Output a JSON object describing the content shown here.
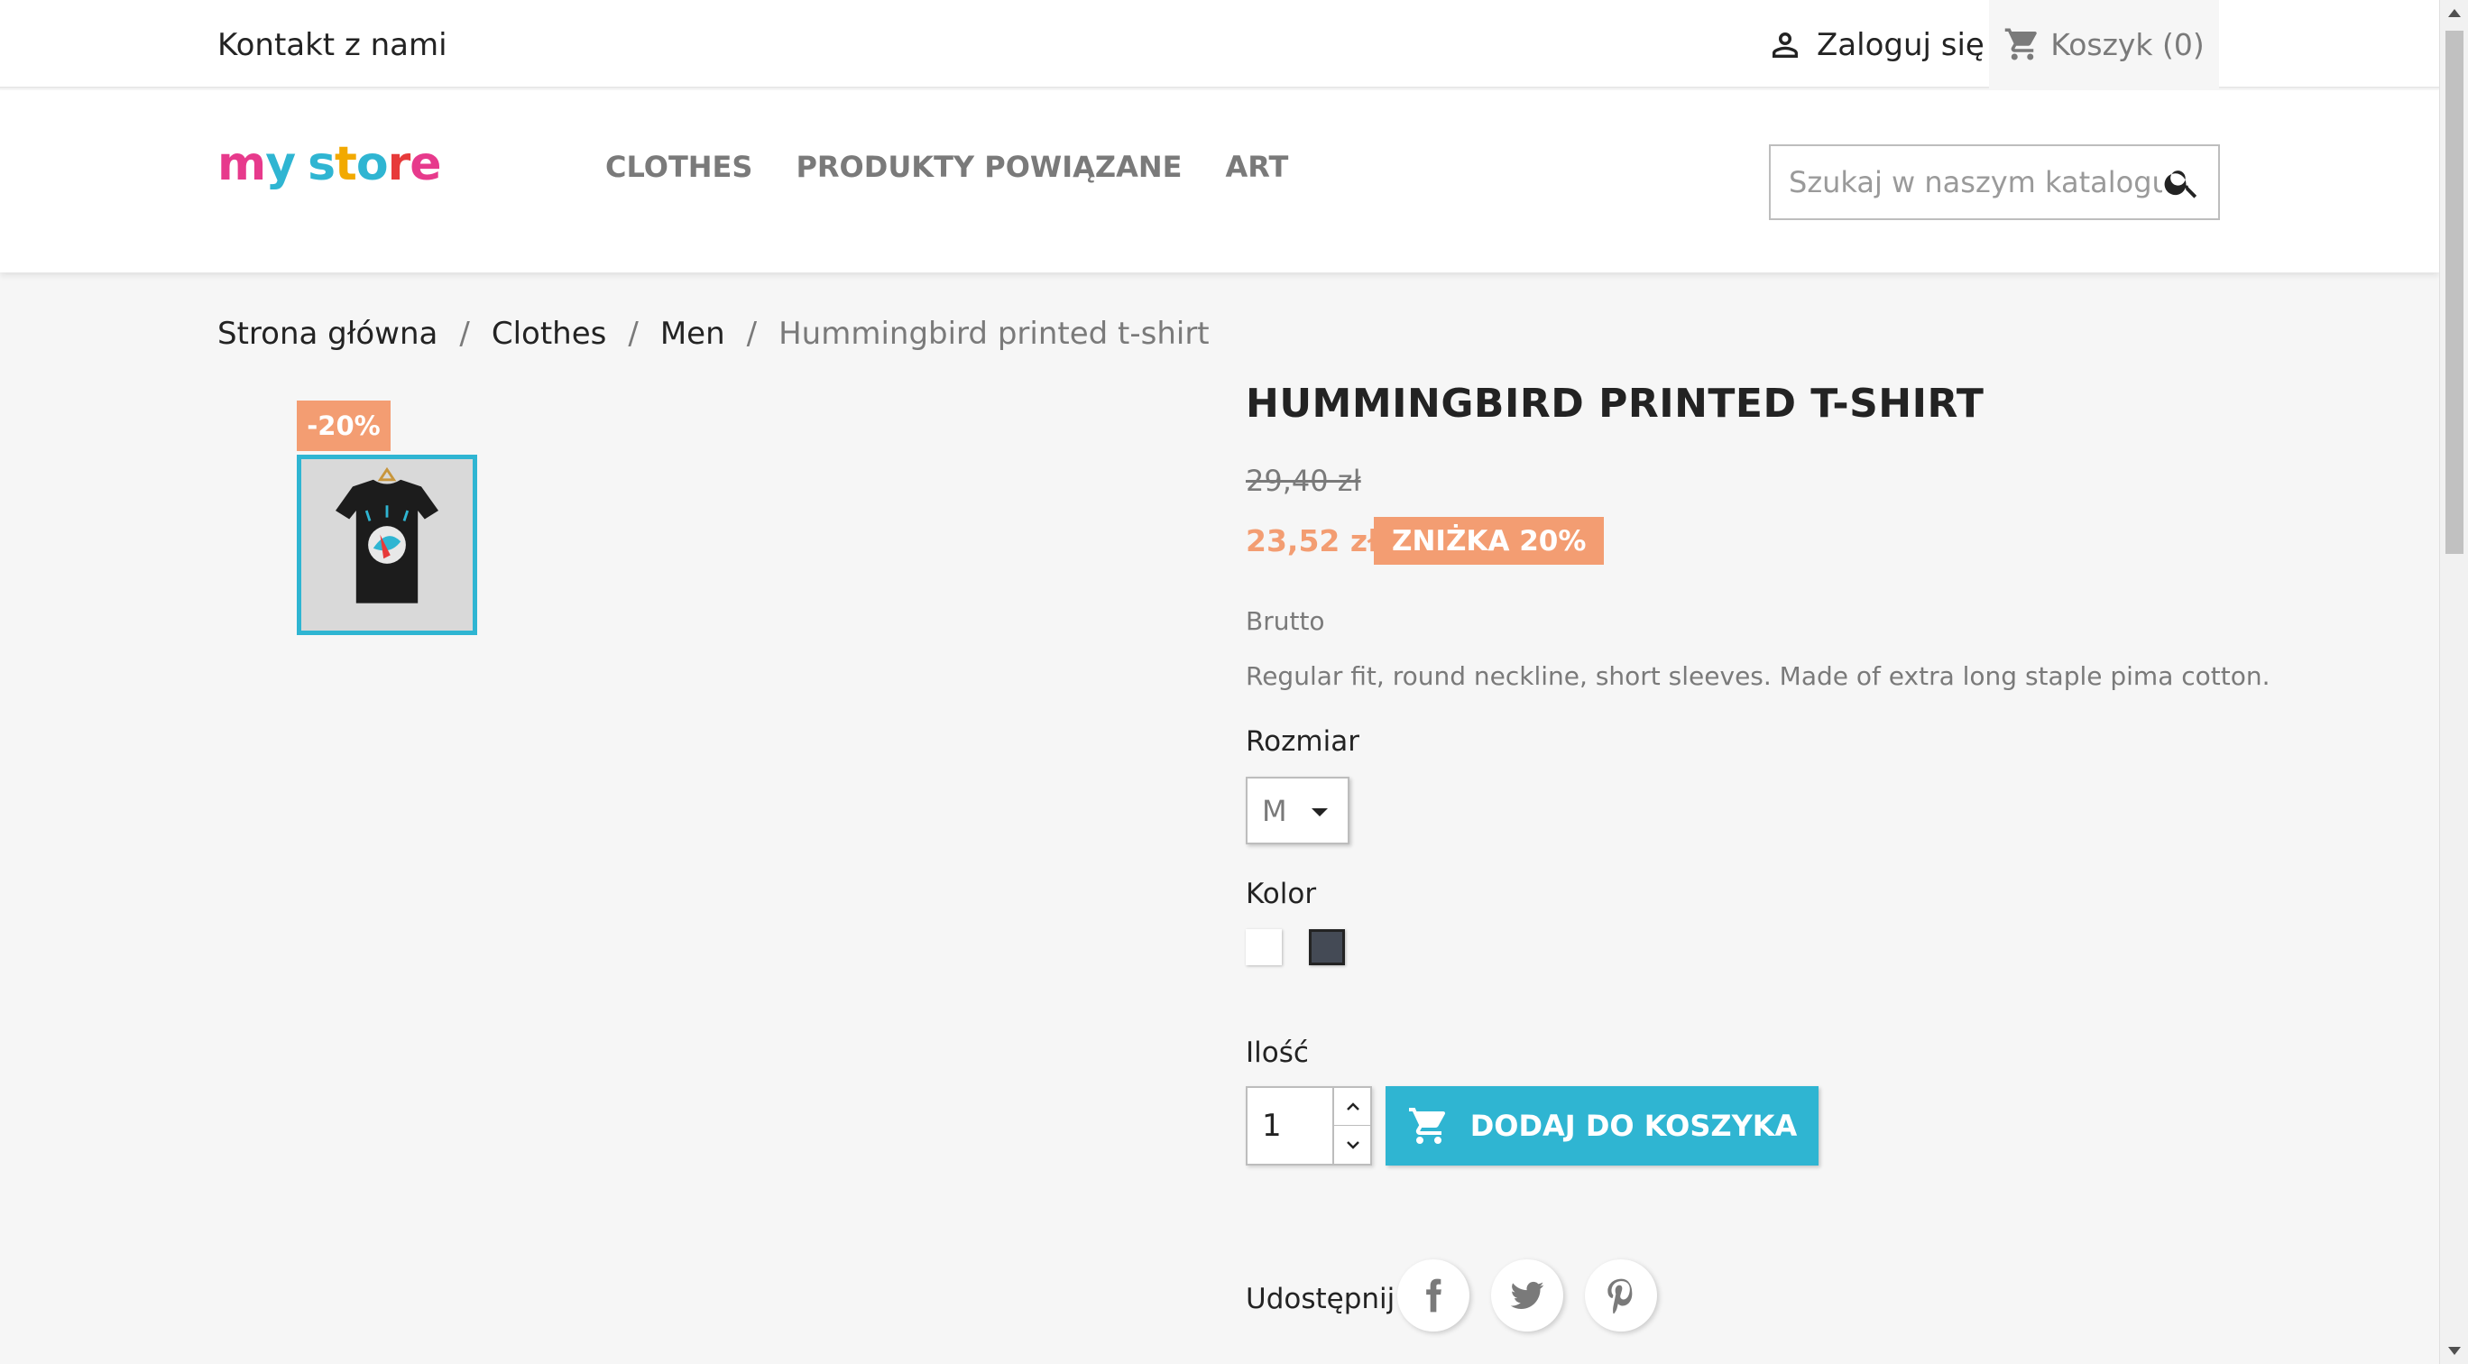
{
  "topbar": {
    "contact": "Kontakt z nami",
    "login": "Zaloguj się",
    "cart": "Koszyk (0)"
  },
  "header": {
    "logo": [
      "m",
      "y",
      " ",
      "s",
      "t",
      "o",
      "r",
      "e"
    ],
    "logo_colors": [
      "#e73a8c",
      "#2fb5d2",
      "#ffffff",
      "#2fb5d2",
      "#f2a900",
      "#2fb5d2",
      "#e73a3a",
      "#e73a8c"
    ],
    "nav": [
      "CLOTHES",
      "PRODUKTY POWIĄZANE",
      "ART"
    ],
    "search_placeholder": "Szukaj w naszym katalogu"
  },
  "breadcrumb": [
    "Strona główna",
    "Clothes",
    "Men",
    "Hummingbird printed t-shirt"
  ],
  "product": {
    "discount_flag": "-20%",
    "title": "HUMMINGBIRD PRINTED T-SHIRT",
    "old_price": "29,40 zł",
    "price": "23,52 zł",
    "discount_badge": "ZNIŻKA 20%",
    "tax_label": "Brutto",
    "description": "Regular fit, round neckline, short sleeves. Made of extra long staple pima cotton.",
    "size_label": "Rozmiar",
    "size_value": "M",
    "color_label": "Kolor",
    "colors": [
      "#ffffff",
      "#444a55"
    ],
    "qty_label": "Ilość",
    "qty_value": "1",
    "add_to_cart": "DODAJ DO KOSZYKA",
    "share_label": "Udostępnij"
  },
  "colors": {
    "accent": "#2fb5d2",
    "discount": "#f39d72"
  }
}
